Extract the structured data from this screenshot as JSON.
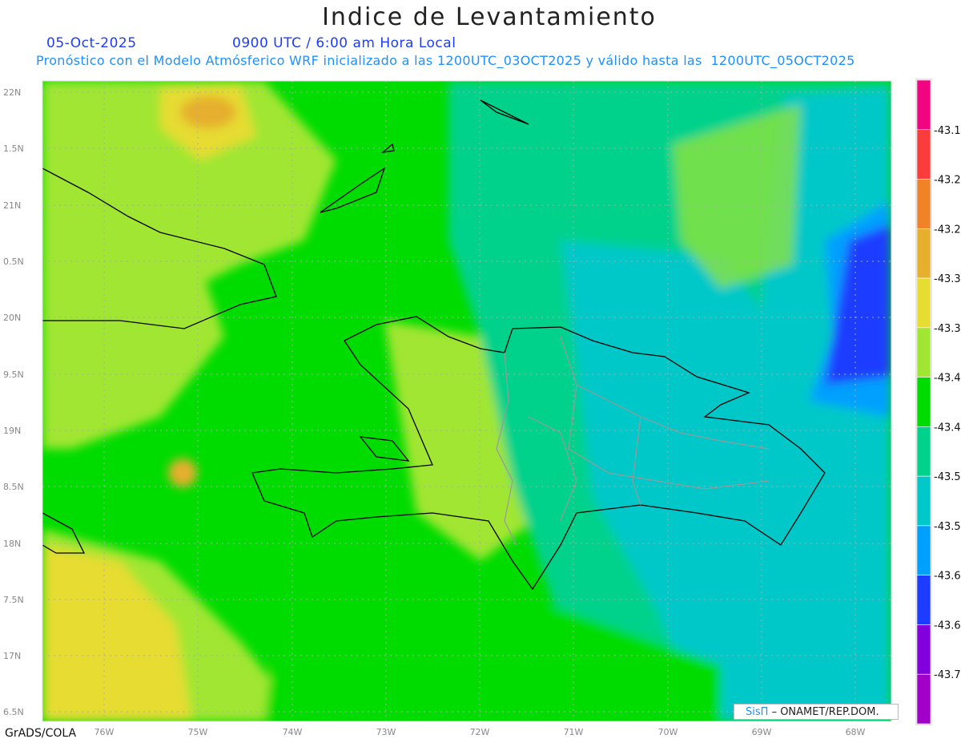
{
  "title": "Indice de Levantamiento",
  "date": "05-Oct-2025",
  "time": "0900 UTC / 6:00 am Hora Local",
  "model_line": "Pronóstico con el Modelo Atmósferico WRF inicializado a las 1200UTC_03OCT2025 y válido hasta las  1200UTC_05OCT2025",
  "footer_left": "GrADS/COLA",
  "credit": {
    "logo": "SisΠ",
    "text": "– ONAMET/REP.DOM."
  },
  "map": {
    "lat_labels": [
      "22N",
      "1.5N",
      "21N",
      "0.5N",
      "20N",
      "9.5N",
      "19N",
      "8.5N",
      "18N",
      "7.5N",
      "17N",
      "6.5N"
    ],
    "lon_labels": [
      "76W",
      "75W",
      "74W",
      "73W",
      "72W",
      "71W",
      "70W",
      "69W",
      "68W"
    ],
    "grid": true,
    "grid_style": "dotted"
  },
  "colorbar": {
    "labels": [
      "-43.1",
      "-43.2",
      "-43.2",
      "-43.3",
      "-43.3",
      "-43.4",
      "-43.4",
      "-43.5",
      "-43.5",
      "-43.6",
      "-43.6",
      "-43.7"
    ],
    "colors": [
      "#f0047f",
      "#fa3c3c",
      "#f08228",
      "#e6af2d",
      "#e6dc32",
      "#a0e632",
      "#00dc00",
      "#00d28c",
      "#00c8c8",
      "#00a0ff",
      "#1e3cff",
      "#8200dc",
      "#a000c8"
    ]
  }
}
